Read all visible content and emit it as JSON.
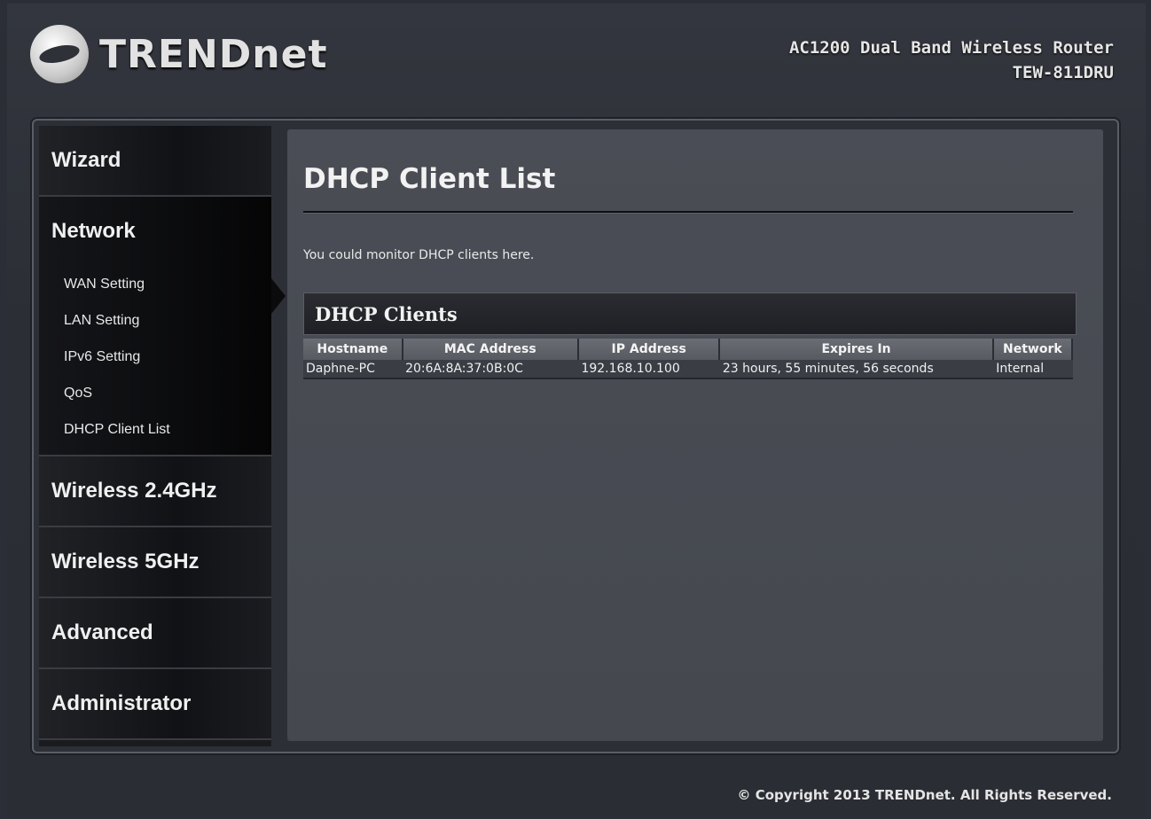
{
  "header": {
    "brand": "TRENDnet",
    "product_name": "AC1200 Dual Band Wireless Router",
    "model": "TEW-811DRU",
    "logo_icon": "trendnet-logo-icon"
  },
  "sidebar": {
    "wizard": "Wizard",
    "network": "Network",
    "network_items": [
      "WAN Setting",
      "LAN Setting",
      "IPv6 Setting",
      "QoS",
      "DHCP Client List"
    ],
    "wireless24": "Wireless 2.4GHz",
    "wireless5": "Wireless 5GHz",
    "advanced": "Advanced",
    "administrator": "Administrator"
  },
  "main": {
    "title": "DHCP Client List",
    "description": "You could monitor DHCP clients here.",
    "clients": {
      "heading": "DHCP Clients",
      "columns": [
        "Hostname",
        "MAC Address",
        "IP Address",
        "Expires In",
        "Network"
      ],
      "rows": [
        {
          "hostname": "Daphne-PC",
          "mac": "20:6A:8A:37:0B:0C",
          "ip": "192.168.10.100",
          "expires": "23 hours, 55 minutes, 56 seconds",
          "network": "Internal"
        }
      ]
    }
  },
  "footer": {
    "copyright": "© Copyright 2013 TRENDnet. All Rights Reserved."
  }
}
